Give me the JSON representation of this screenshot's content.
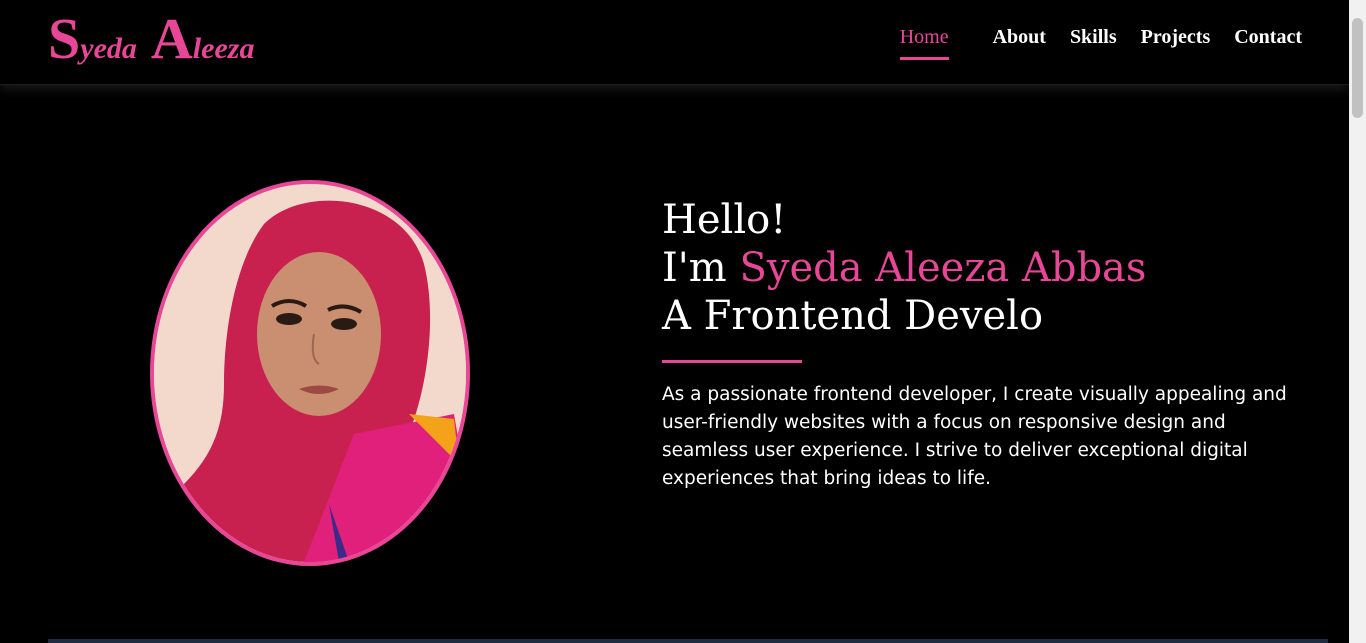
{
  "logo": {
    "first_initial": "S",
    "first_rest": "yeda",
    "last_initial": "A",
    "last_rest": "leeza"
  },
  "nav": {
    "home": "Home",
    "about": "About",
    "skills": "Skills",
    "projects": "Projects",
    "contact": "Contact"
  },
  "hero": {
    "line1": "Hello!",
    "line2_prefix": "I'm ",
    "name": "Syeda Aleeza Abbas",
    "line3": "A Frontend Develo",
    "bio": "As a passionate frontend developer, I create visually appealing and user-friendly websites with a focus on responsive design and seamless user experience. I strive to deliver exceptional digital experiences that bring ideas to life."
  },
  "colors": {
    "accent": "#e84797",
    "background": "#000000",
    "text": "#ffffff"
  }
}
